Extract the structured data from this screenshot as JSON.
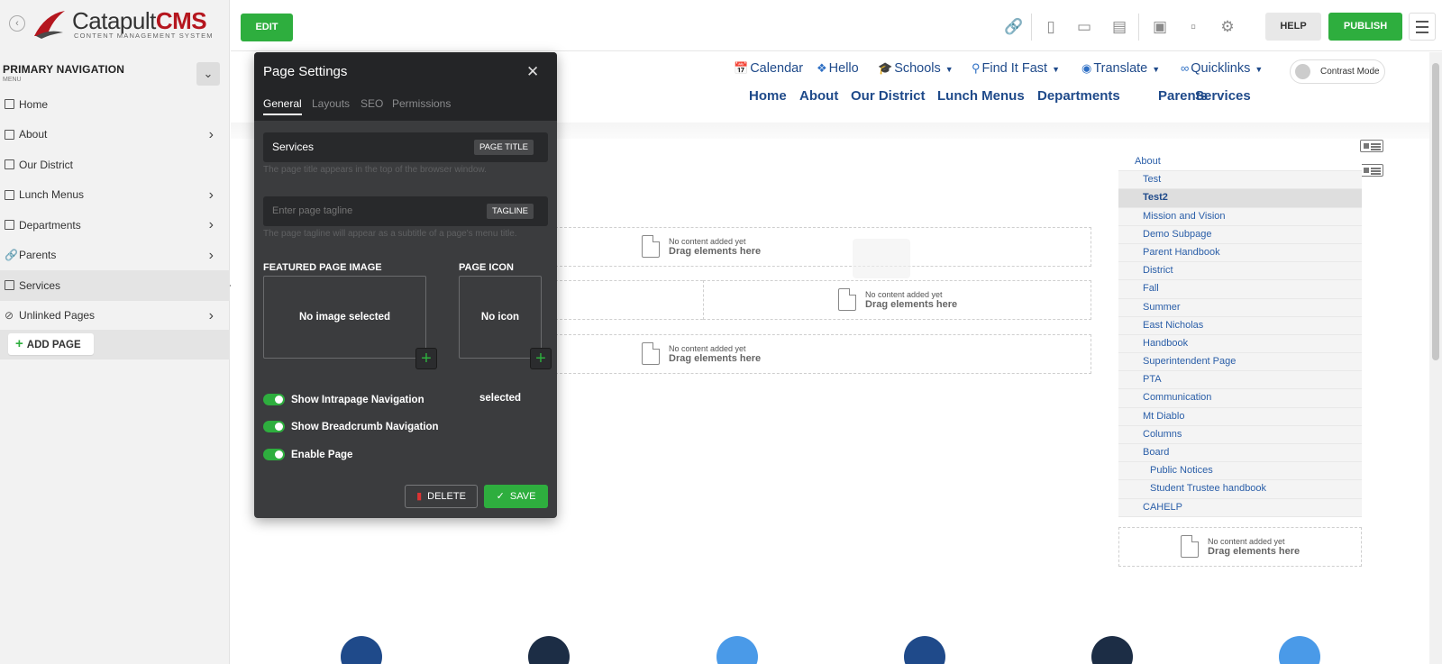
{
  "app": {
    "logo_main": "Catapult",
    "logo_accent": "CMS",
    "logo_sub": "CONTENT MANAGEMENT SYSTEM",
    "back_icon": "chevron-left-icon",
    "brand_color": "#b5161e"
  },
  "sidebar": {
    "heading": "PRIMARY NAVIGATION",
    "subheading": "MENU",
    "items": [
      {
        "label": "Home",
        "icon": "page-icon",
        "has_children": false
      },
      {
        "label": "About",
        "icon": "page-icon",
        "has_children": true
      },
      {
        "label": "Our District",
        "icon": "page-icon",
        "has_children": false
      },
      {
        "label": "Lunch Menus",
        "icon": "page-icon",
        "has_children": true
      },
      {
        "label": "Departments",
        "icon": "page-icon",
        "has_children": true
      },
      {
        "label": "Parents",
        "icon": "link-icon",
        "has_children": true
      },
      {
        "label": "Services",
        "icon": "page-icon",
        "has_children": false,
        "active": true
      },
      {
        "label": "Unlinked Pages",
        "icon": "hidden-icon",
        "has_children": true
      }
    ],
    "add_page_label": "ADD PAGE"
  },
  "toolbar": {
    "edit_label": "EDIT",
    "help_label": "HELP",
    "publish_label": "PUBLISH",
    "icons": [
      "link-icon",
      "phone-icon",
      "tablet-icon",
      "desktop-icon",
      "image-icon",
      "file-icon",
      "gear-icon"
    ],
    "accent_color": "#2eae3e"
  },
  "site": {
    "utility_links": [
      {
        "label": "Calendar",
        "icon": "calendar-icon",
        "dropdown": false
      },
      {
        "label": "Hello",
        "icon": "people-icon",
        "dropdown": false
      },
      {
        "label": "Schools",
        "icon": "graduation-cap-icon",
        "dropdown": true
      },
      {
        "label": "Find It Fast",
        "icon": "search-icon",
        "dropdown": true
      },
      {
        "label": "Translate",
        "icon": "globe-icon",
        "dropdown": true
      },
      {
        "label": "Quicklinks",
        "icon": "link-icon",
        "dropdown": true
      }
    ],
    "contrast_label": "Contrast Mode",
    "main_nav": [
      "Home",
      "About",
      "Our District",
      "Lunch Menus",
      "Departments",
      "Parents",
      "Services"
    ],
    "dropzone": {
      "line1": "No content added yet",
      "line2": "Drag elements here"
    },
    "subnav": [
      {
        "label": "About",
        "level": 0
      },
      {
        "label": "Test",
        "level": 1
      },
      {
        "label": "Test2",
        "level": 1,
        "active": true
      },
      {
        "label": "Mission and Vision",
        "level": 1
      },
      {
        "label": "Demo Subpage",
        "level": 1
      },
      {
        "label": "Parent Handbook",
        "level": 1
      },
      {
        "label": "District",
        "level": 1
      },
      {
        "label": "Fall",
        "level": 1
      },
      {
        "label": "Summer",
        "level": 1
      },
      {
        "label": "East Nicholas",
        "level": 1
      },
      {
        "label": "Handbook",
        "level": 1
      },
      {
        "label": "Superintendent Page",
        "level": 1
      },
      {
        "label": "PTA",
        "level": 1
      },
      {
        "label": "Communication",
        "level": 1
      },
      {
        "label": "Mt Diablo",
        "level": 1
      },
      {
        "label": "Columns",
        "level": 1
      },
      {
        "label": "Board",
        "level": 1
      },
      {
        "label": "Public Notices",
        "level": 2
      },
      {
        "label": "Student Trustee handbook",
        "level": 2
      },
      {
        "label": "CAHELP",
        "level": 1
      }
    ],
    "nav_color": "#1f4a8a"
  },
  "modal": {
    "title": "Page Settings",
    "close_icon": "close-icon",
    "tabs": [
      "General",
      "Layouts",
      "SEO",
      "Permissions"
    ],
    "active_tab": "General",
    "page_title_value": "Services",
    "page_title_tag": "PAGE TITLE",
    "page_title_hint": "The page title appears in the top of the browser window.",
    "tagline_placeholder": "Enter page tagline",
    "tagline_tag": "TAGLINE",
    "tagline_hint": "The page tagline will appear as a subtitle of a page's menu title.",
    "featured_label": "FEATURED PAGE IMAGE",
    "featured_empty": "No image selected",
    "icon_label": "PAGE ICON",
    "icon_empty": "No icon selected",
    "toggles": [
      {
        "label": "Show Intrapage Navigation",
        "on": true
      },
      {
        "label": "Show Breadcrumb Navigation",
        "on": true
      },
      {
        "label": "Enable Page",
        "on": true
      }
    ],
    "delete_label": "DELETE",
    "save_label": "SAVE"
  }
}
